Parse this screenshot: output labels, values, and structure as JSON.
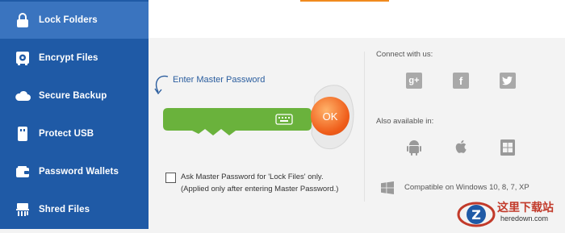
{
  "sidebar": {
    "items": [
      {
        "label": "Lock Folders",
        "icon": "lock-icon",
        "active": true
      },
      {
        "label": "Encrypt Files",
        "icon": "safe-icon",
        "active": false
      },
      {
        "label": "Secure Backup",
        "icon": "cloud-icon",
        "active": false
      },
      {
        "label": "Protect USB",
        "icon": "usb-icon",
        "active": false
      },
      {
        "label": "Password Wallets",
        "icon": "wallet-icon",
        "active": false
      },
      {
        "label": "Shred Files",
        "icon": "shredder-icon",
        "active": false
      }
    ]
  },
  "main": {
    "enter_password_label": "Enter Master Password",
    "ok_label": "OK",
    "ask_checkbox_label": "Ask Master Password for 'Lock Files' only.",
    "ask_note": "(Applied only after entering Master Password.)",
    "ask_checked": false
  },
  "right_panel": {
    "connect_title": "Connect with us:",
    "social": [
      "google-plus-icon",
      "facebook-icon",
      "twitter-icon"
    ],
    "available_title": "Also available in:",
    "platforms": [
      "android-icon",
      "apple-icon",
      "windows-phone-icon"
    ],
    "compatible_text": "Compatible on Windows 10, 8, 7, XP"
  },
  "watermark": {
    "title": "这里下载站",
    "url": "heredown.com"
  },
  "colors": {
    "sidebar": "#1f5aa6",
    "sidebar_active": "#3a74bf",
    "key_green": "#6ab23c",
    "ok_orange": "#ef5d1a",
    "accent_orange": "#f08a1e"
  }
}
